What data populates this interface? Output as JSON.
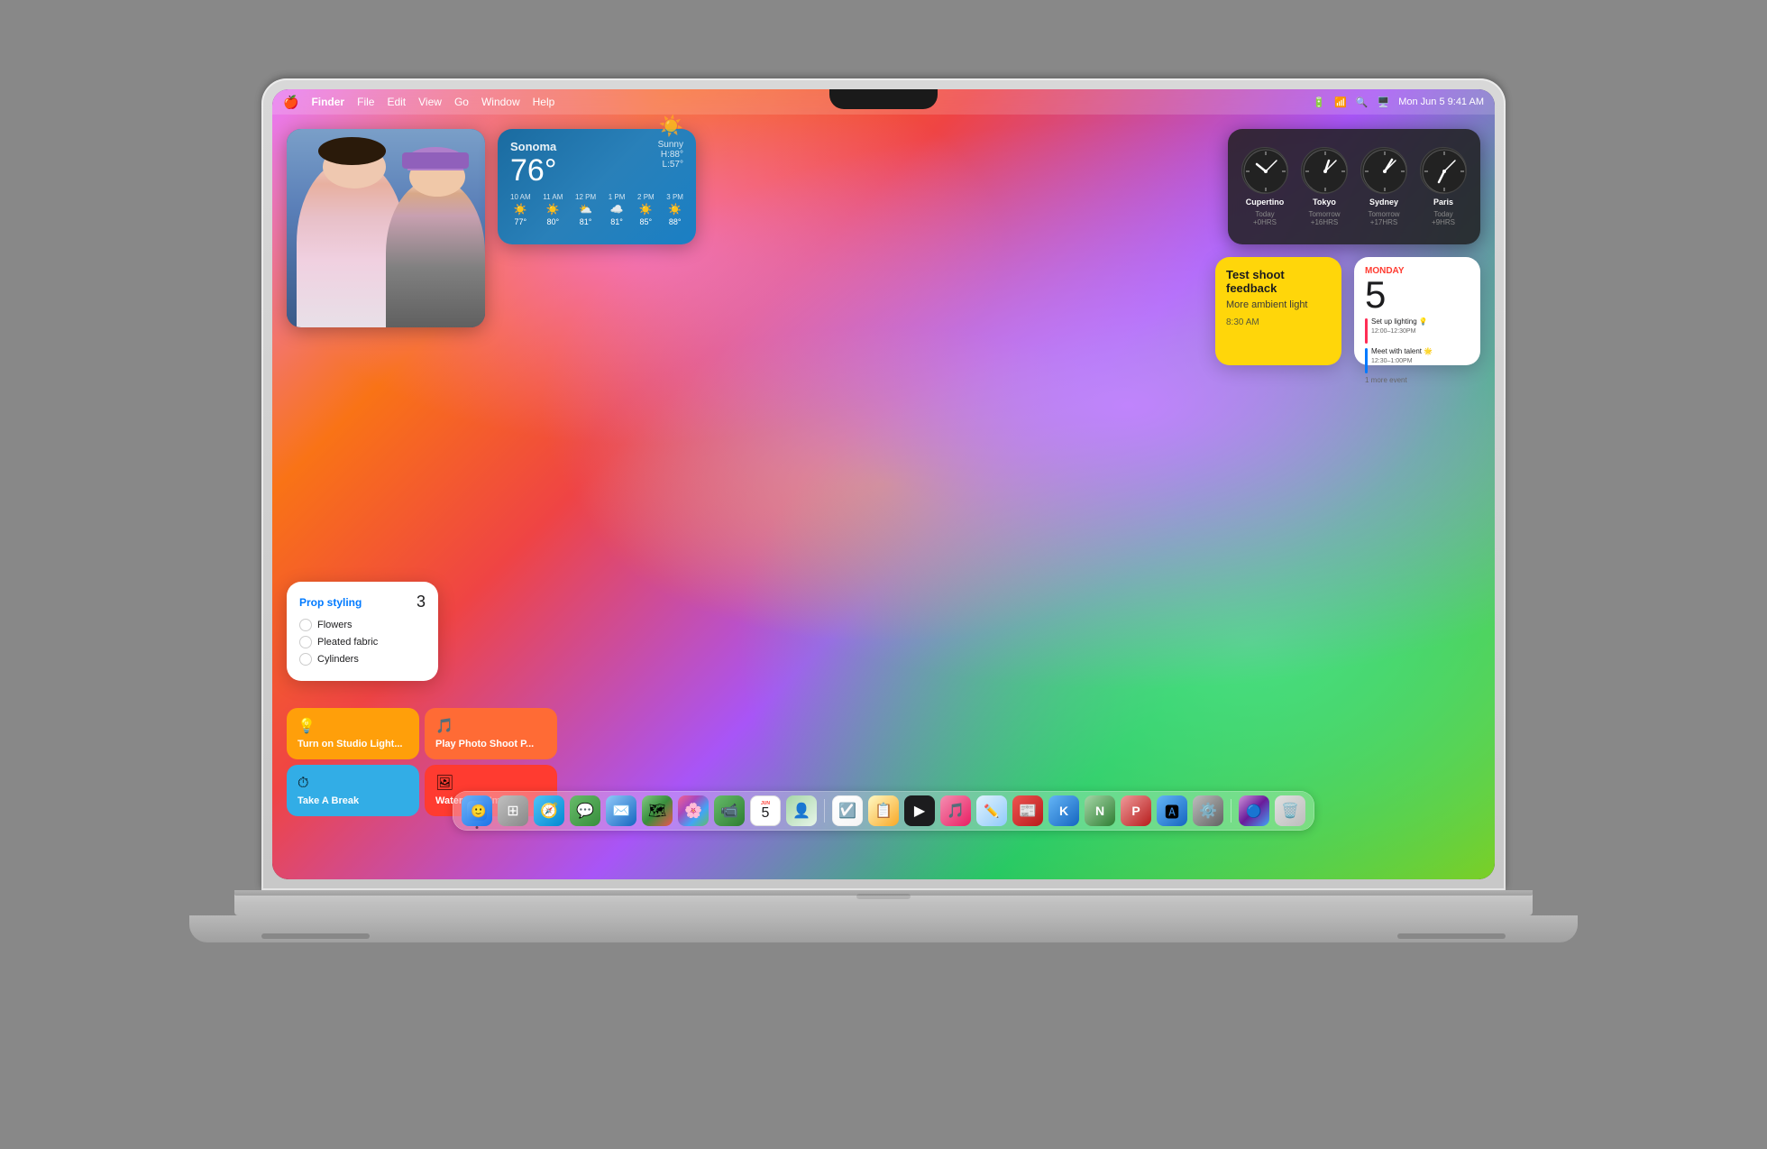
{
  "menubar": {
    "apple": "🍎",
    "finder": "Finder",
    "menus": [
      "File",
      "Edit",
      "View",
      "Go",
      "Window",
      "Help"
    ],
    "time": "Mon Jun 5  9:41 AM",
    "status_icons": [
      "🔋",
      "📶",
      "🔍",
      "🖥️"
    ]
  },
  "weather": {
    "location": "Sonoma",
    "temp": "76°",
    "condition": "Sunny",
    "high": "H:88°",
    "low": "L:57°",
    "hourly": [
      {
        "time": "10 AM",
        "icon": "☀️",
        "temp": "77°"
      },
      {
        "time": "11 AM",
        "icon": "☀️",
        "temp": "80°"
      },
      {
        "time": "12 PM",
        "icon": "⛅",
        "temp": "81°"
      },
      {
        "time": "1 PM",
        "icon": "☁️",
        "temp": "81°"
      },
      {
        "time": "2 PM",
        "icon": "☀️",
        "temp": "85°"
      },
      {
        "time": "3 PM",
        "icon": "☀️",
        "temp": "88°"
      }
    ]
  },
  "clocks": [
    {
      "city": "Cupertino",
      "zone": "Today\n+0HRS",
      "hour_angle": -60,
      "min_angle": 30
    },
    {
      "city": "Tokyo",
      "zone": "Tomorrow\n+16HRS",
      "hour_angle": 20,
      "min_angle": 30
    },
    {
      "city": "Sydney",
      "zone": "Tomorrow\n+17HRS",
      "hour_angle": 40,
      "min_angle": 30
    },
    {
      "city": "Paris",
      "zone": "Today\n+9HRS",
      "hour_angle": 120,
      "min_angle": 30
    }
  ],
  "calendar": {
    "day_label": "MONDAY",
    "date": "5",
    "events": [
      {
        "label": "Set up lighting 💡\n12:00–12:30PM",
        "color": "pink"
      },
      {
        "label": "Meet with talent 🌟\n12:30–1:00PM",
        "color": "blue"
      }
    ],
    "more": "1 more event"
  },
  "notes": {
    "title": "Test shoot feedback",
    "content": "More ambient light",
    "time": "8:30 AM"
  },
  "reminders": {
    "title": "Prop styling",
    "count": "3",
    "items": [
      "Flowers",
      "Pleated fabric",
      "Cylinders"
    ]
  },
  "shortcuts": [
    {
      "label": "Turn on Studio Light...",
      "icon": "💡",
      "color": "yellow"
    },
    {
      "label": "Play Photo Shoot P...",
      "icon": "🎵",
      "color": "orange"
    },
    {
      "label": "Take A Break",
      "icon": "⏱",
      "color": "teal"
    },
    {
      "label": "Watermark Images",
      "icon": "🖼",
      "color": "red"
    }
  ],
  "dock": {
    "icons": [
      {
        "name": "Finder",
        "emoji": "🟡",
        "class": "dock-finder",
        "dot": true
      },
      {
        "name": "Launchpad",
        "emoji": "⊞",
        "class": "dock-launchpad",
        "dot": false
      },
      {
        "name": "Safari",
        "emoji": "🧭",
        "class": "dock-safari",
        "dot": false
      },
      {
        "name": "Messages",
        "emoji": "💬",
        "class": "dock-messages",
        "dot": false
      },
      {
        "name": "Mail",
        "emoji": "✉️",
        "class": "dock-mail",
        "dot": false
      },
      {
        "name": "Maps",
        "emoji": "🗺",
        "class": "dock-maps",
        "dot": false
      },
      {
        "name": "Photos",
        "emoji": "🌸",
        "class": "dock-photos",
        "dot": false
      },
      {
        "name": "FaceTime",
        "emoji": "📹",
        "class": "dock-facetime",
        "dot": false
      },
      {
        "name": "Calendar",
        "emoji": "5",
        "class": "dock-calendar",
        "dot": false
      },
      {
        "name": "Contacts",
        "emoji": "👤",
        "class": "dock-contacts",
        "dot": false
      },
      {
        "name": "Reminders",
        "emoji": "☑",
        "class": "dock-reminders",
        "dot": false
      },
      {
        "name": "Notes",
        "emoji": "📝",
        "class": "dock-notes",
        "dot": false
      },
      {
        "name": "AppleTV",
        "emoji": "▶",
        "class": "dock-appletv",
        "dot": false
      },
      {
        "name": "Music",
        "emoji": "♪",
        "class": "dock-music",
        "dot": false
      },
      {
        "name": "Freeform",
        "emoji": "✏",
        "class": "dock-freeform",
        "dot": false
      },
      {
        "name": "News",
        "emoji": "📰",
        "class": "dock-news",
        "dot": false
      },
      {
        "name": "Keynote",
        "emoji": "K",
        "class": "dock-keynote",
        "dot": false
      },
      {
        "name": "Numbers",
        "emoji": "N",
        "class": "dock-numbers",
        "dot": false
      },
      {
        "name": "Pages",
        "emoji": "P",
        "class": "dock-pages",
        "dot": false
      },
      {
        "name": "AppStore",
        "emoji": "A",
        "class": "dock-appstore",
        "dot": false
      },
      {
        "name": "Settings",
        "emoji": "⚙",
        "class": "dock-settings",
        "dot": false
      },
      {
        "name": "Siri",
        "emoji": "S",
        "class": "dock-siri",
        "dot": false
      },
      {
        "name": "Trash",
        "emoji": "🗑",
        "class": "dock-trash",
        "dot": false
      }
    ]
  }
}
